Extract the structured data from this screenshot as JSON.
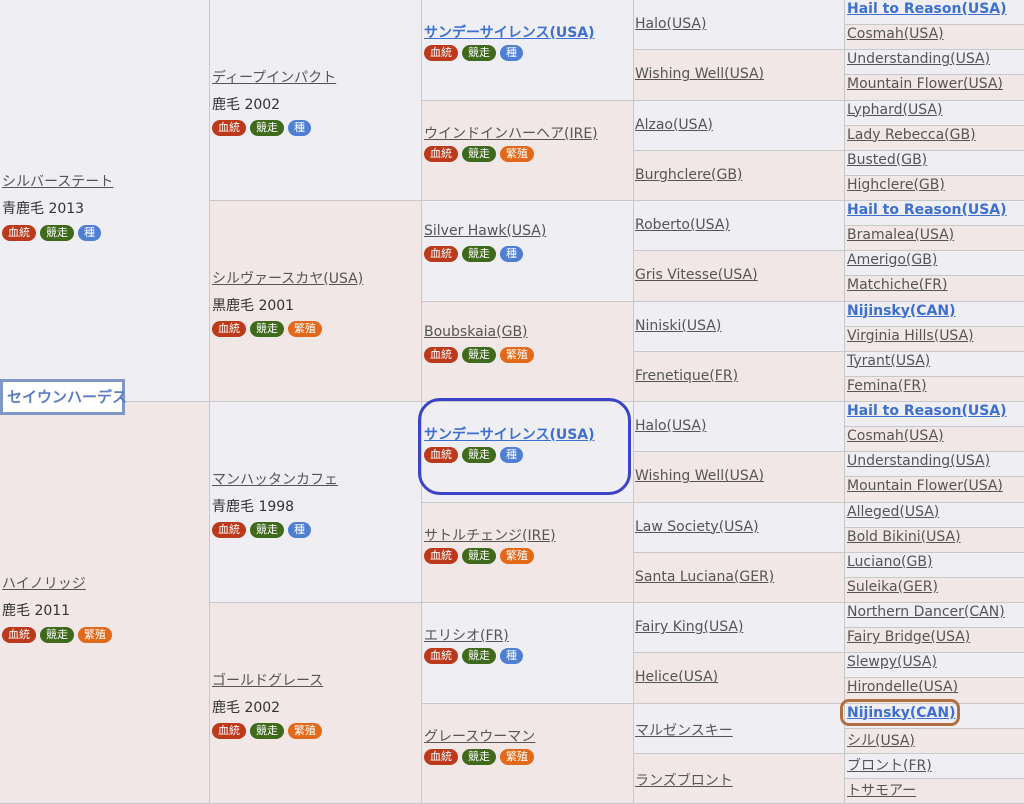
{
  "tags": {
    "blood": "血統",
    "race": "競走",
    "sire": "種",
    "broodmare": "繁殖"
  },
  "focal": {
    "name": "セイウンハーデス"
  },
  "gen1": [
    {
      "name": "シルバーステート",
      "coat": "青鹿毛 2013",
      "tags": [
        "blood",
        "race",
        "sire"
      ]
    },
    {
      "name": "ハイノリッジ",
      "coat": "鹿毛 2011",
      "tags": [
        "blood",
        "race",
        "broodmare"
      ]
    }
  ],
  "gen2": [
    {
      "name": "ディープインパクト",
      "coat": "鹿毛 2002",
      "tags": [
        "blood",
        "race",
        "sire"
      ]
    },
    {
      "name": "シルヴァースカヤ(USA)",
      "coat": "黒鹿毛 2001",
      "tags": [
        "blood",
        "race",
        "broodmare"
      ]
    },
    {
      "name": "マンハッタンカフェ",
      "coat": "青鹿毛 1998",
      "tags": [
        "blood",
        "race",
        "sire"
      ]
    },
    {
      "name": "ゴールドグレース",
      "coat": "鹿毛 2002",
      "tags": [
        "blood",
        "race",
        "broodmare"
      ]
    }
  ],
  "gen3": [
    {
      "name": "サンデーサイレンス(USA)",
      "highlight": true,
      "tags": [
        "blood",
        "race",
        "sire"
      ]
    },
    {
      "name": "ウインドインハーヘア(IRE)",
      "highlight": false,
      "tags": [
        "blood",
        "race",
        "broodmare"
      ]
    },
    {
      "name": "Silver Hawk(USA)",
      "highlight": false,
      "tags": [
        "blood",
        "race",
        "sire"
      ]
    },
    {
      "name": "Boubskaia(GB)",
      "highlight": false,
      "tags": [
        "blood",
        "race",
        "broodmare"
      ]
    },
    {
      "name": "サンデーサイレンス(USA)",
      "highlight": true,
      "tags": [
        "blood",
        "race",
        "sire"
      ]
    },
    {
      "name": "サトルチェンジ(IRE)",
      "highlight": false,
      "tags": [
        "blood",
        "race",
        "broodmare"
      ]
    },
    {
      "name": "エリシオ(FR)",
      "highlight": false,
      "tags": [
        "blood",
        "race",
        "sire"
      ]
    },
    {
      "name": "グレースウーマン",
      "highlight": false,
      "tags": [
        "blood",
        "race",
        "broodmare"
      ]
    }
  ],
  "gen4": [
    "Halo(USA)",
    "Wishing Well(USA)",
    "Alzao(USA)",
    "Burghclere(GB)",
    "Roberto(USA)",
    "Gris Vitesse(USA)",
    "Niniski(USA)",
    "Frenetique(FR)",
    "Halo(USA)",
    "Wishing Well(USA)",
    "Law Society(USA)",
    "Santa Luciana(GER)",
    "Fairy King(USA)",
    "Helice(USA)",
    "マルゼンスキー",
    "ランズブロント"
  ],
  "gen5": [
    {
      "name": "Hail to Reason(USA)",
      "highlight": true
    },
    {
      "name": "Cosmah(USA)",
      "highlight": false
    },
    {
      "name": "Understanding(USA)",
      "highlight": false
    },
    {
      "name": "Mountain Flower(USA)",
      "highlight": false
    },
    {
      "name": "Lyphard(USA)",
      "highlight": false
    },
    {
      "name": "Lady Rebecca(GB)",
      "highlight": false
    },
    {
      "name": "Busted(GB)",
      "highlight": false
    },
    {
      "name": "Highclere(GB)",
      "highlight": false
    },
    {
      "name": "Hail to Reason(USA)",
      "highlight": true
    },
    {
      "name": "Bramalea(USA)",
      "highlight": false
    },
    {
      "name": "Amerigo(GB)",
      "highlight": false
    },
    {
      "name": "Matchiche(FR)",
      "highlight": false
    },
    {
      "name": "Nijinsky(CAN)",
      "highlight": true
    },
    {
      "name": "Virginia Hills(USA)",
      "highlight": false
    },
    {
      "name": "Tyrant(USA)",
      "highlight": false
    },
    {
      "name": "Femina(FR)",
      "highlight": false
    },
    {
      "name": "Hail to Reason(USA)",
      "highlight": true
    },
    {
      "name": "Cosmah(USA)",
      "highlight": false
    },
    {
      "name": "Understanding(USA)",
      "highlight": false
    },
    {
      "name": "Mountain Flower(USA)",
      "highlight": false
    },
    {
      "name": "Alleged(USA)",
      "highlight": false
    },
    {
      "name": "Bold Bikini(USA)",
      "highlight": false
    },
    {
      "name": "Luciano(GB)",
      "highlight": false
    },
    {
      "name": "Suleika(GER)",
      "highlight": false
    },
    {
      "name": "Northern Dancer(CAN)",
      "highlight": false
    },
    {
      "name": "Fairy Bridge(USA)",
      "highlight": false
    },
    {
      "name": "Slewpy(USA)",
      "highlight": false
    },
    {
      "name": "Hirondelle(USA)",
      "highlight": false
    },
    {
      "name": "Nijinsky(CAN)",
      "highlight": true
    },
    {
      "name": "シル(USA)",
      "highlight": false
    },
    {
      "name": "ブロント(FR)",
      "highlight": false
    },
    {
      "name": "トサモアー",
      "highlight": false
    }
  ],
  "colors": {
    "sire_bg": "#efeff3",
    "dam_bg": "#f1e7e7",
    "highlight_link": "#3d6fd0",
    "blue_circle": "#3b43c9",
    "brown_circle": "#b07043"
  }
}
